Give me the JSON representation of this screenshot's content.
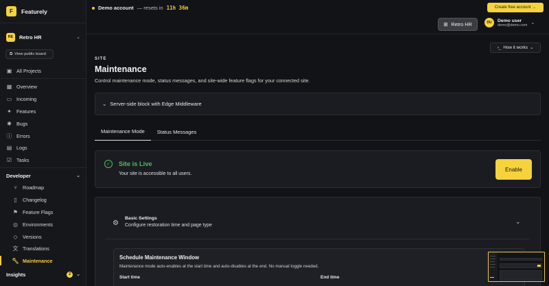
{
  "app": {
    "name": "Featurely",
    "logo_letter": "F"
  },
  "workspace": {
    "badge": "RE",
    "name": "Retro HR"
  },
  "sidebar": {
    "public_board_label": "View public board",
    "all_projects": "All Projects",
    "items": [
      {
        "label": "Overview",
        "icon": "grid-icon"
      },
      {
        "label": "Incoming",
        "icon": "inbox-icon"
      },
      {
        "label": "Features",
        "icon": "puzzle-icon"
      },
      {
        "label": "Bugs",
        "icon": "bug-icon"
      },
      {
        "label": "Errors",
        "icon": "alert-circle-icon"
      },
      {
        "label": "Logs",
        "icon": "file-text-icon"
      },
      {
        "label": "Tasks",
        "icon": "checkbox-icon"
      }
    ],
    "developer": {
      "title": "Developer",
      "items": [
        {
          "label": "Roadmap",
          "icon": "git-branch-icon"
        },
        {
          "label": "Changelog",
          "icon": "document-icon"
        },
        {
          "label": "Feature Flags",
          "icon": "flag-icon"
        },
        {
          "label": "Environments",
          "icon": "globe-icon"
        },
        {
          "label": "Versions",
          "icon": "tag-icon"
        },
        {
          "label": "Translations",
          "icon": "language-icon"
        },
        {
          "label": "Maintenance",
          "icon": "wrench-icon",
          "active": true
        }
      ]
    },
    "insights": {
      "title": "Insights",
      "badge": "2"
    }
  },
  "topbar": {
    "demo_account": "Demo account",
    "resets_in": "— resets in",
    "timer": "11h 36m",
    "create_account": "Create free account →",
    "project_button": "Retro HR",
    "user": {
      "initials": "DU",
      "name": "Demo user",
      "email": "demo@demo.com"
    }
  },
  "main": {
    "how_it_works": "How it works",
    "eyebrow": "SITE",
    "title": "Maintenance",
    "description": "Control maintenance mode, status messages, and site-wide feature flags for your connected site.",
    "accordion_label": "Server-side block with Edge Middleware",
    "tabs": [
      "Maintenance Mode",
      "Status Messages"
    ],
    "status": {
      "title": "Site is Live",
      "description": "Your site is accessible to all users.",
      "button": "Enable",
      "color": "#4cbf5e"
    },
    "basic_settings": {
      "title": "Basic Settings",
      "description": "Configure restoration time and page type"
    },
    "schedule": {
      "title": "Schedule Maintenance Window",
      "description": "Maintenance mode auto-enables at the start time and auto-disables at the end. No manual toggle needed.",
      "start_label": "Start time",
      "end_label": "End time"
    }
  },
  "colors": {
    "accent": "#f6d33c",
    "background": "#121317",
    "success": "#4cbf5e"
  }
}
